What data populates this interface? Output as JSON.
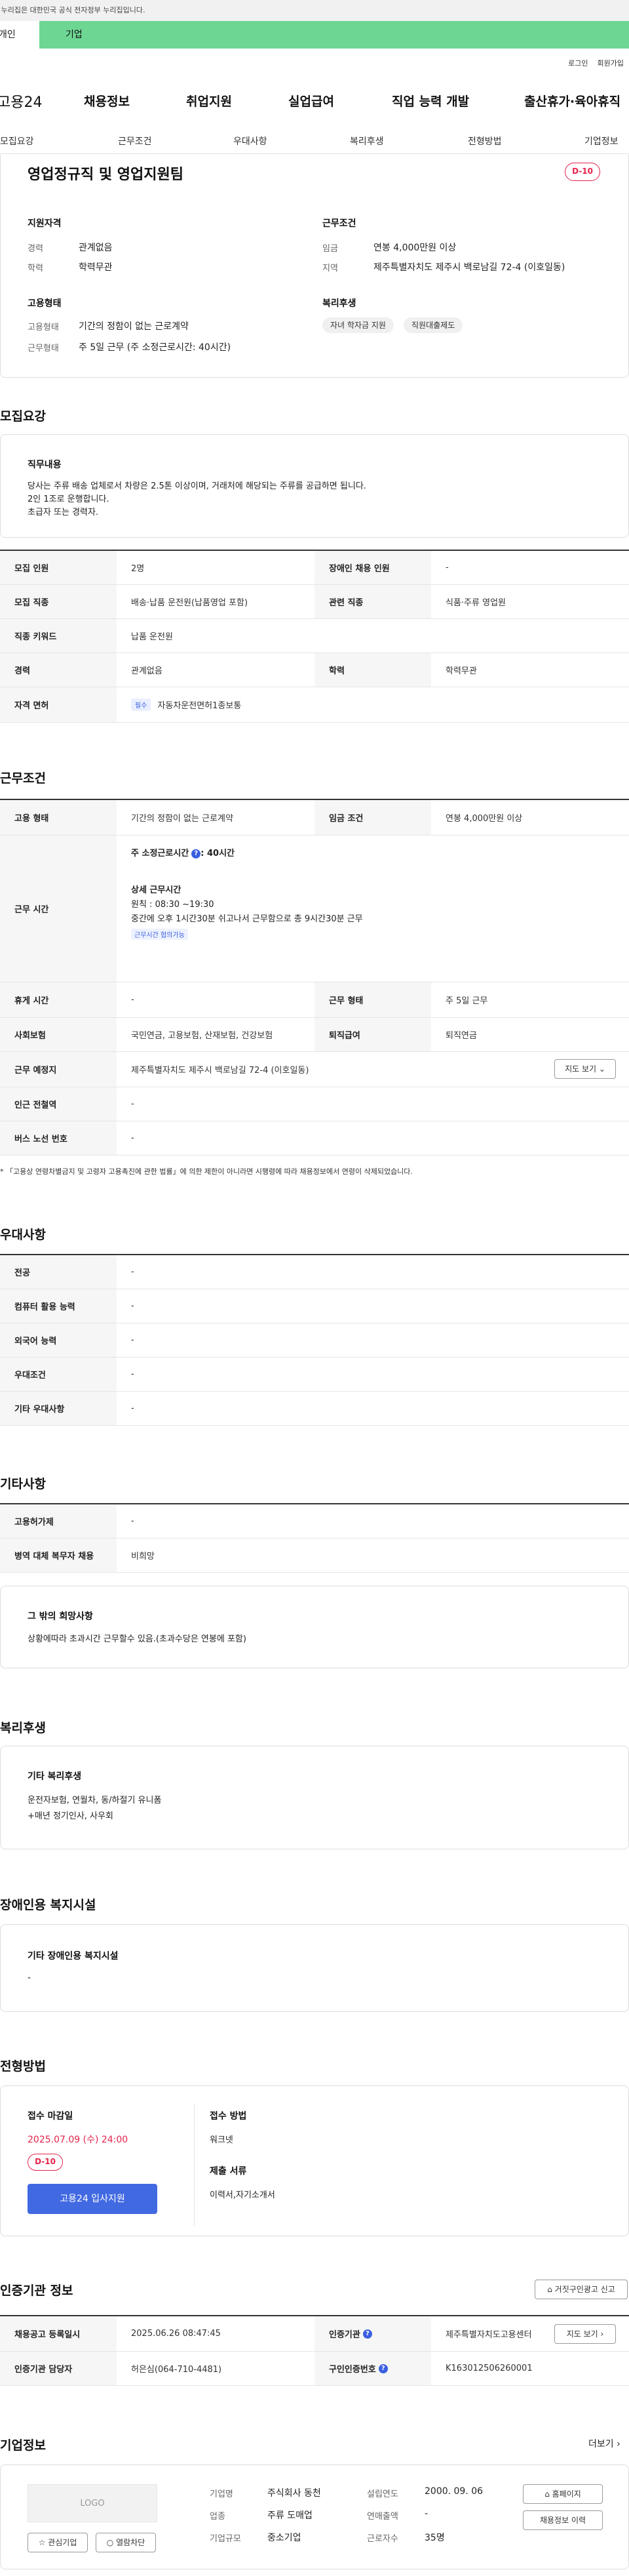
{
  "gov_banner": "이 누리집은 대한민국 공식 전자정부 누리집입니다.",
  "tabs": {
    "individual": "개인",
    "business": "기업"
  },
  "util": [
    "로그인",
    "회원가입"
  ],
  "gnb": {
    "logo": "고용24",
    "items": [
      "채용정보",
      "취업지원",
      "실업급여",
      "직업 능력 개발",
      "출산휴가·육아휴직"
    ]
  },
  "lnb": [
    "모집요강",
    "근무조건",
    "우대사항",
    "복리후생",
    "전형방법",
    "기업정보"
  ],
  "summary": {
    "title": "영업정규직 및 영업지원팀",
    "dday": "D-10",
    "qual_h": "지원자격",
    "career_l": "경력",
    "career_v": "관계없음",
    "edu_l": "학력",
    "edu_v": "학력무관",
    "cond_h": "근무조건",
    "wage_l": "임금",
    "wage_v": "연봉 4,000만원 이상",
    "region_l": "지역",
    "region_v": "제주특별자치도 제주시 백로남길 72-4 (이호일동)",
    "emp_h": "고용형태",
    "emptype_l": "고용형태",
    "emptype_v": "기간의 정함이 없는 근로계약",
    "worktype_l": "근무형태",
    "worktype_v": "주 5일 근무 (주 소정근로시간: 40시간)",
    "welfare_h": "복리후생",
    "chips": [
      "자녀 학자금 지원",
      "직원대출제도"
    ]
  },
  "recruit": {
    "h": "모집요강",
    "duty_h": "직무내용",
    "duty_lines": [
      "당사는 주류 배송 업체로서 차량은 2.5톤 이상이며, 거래처에 해당되는 주류를 공급하면 됩니다.",
      "2인 1조로 운행합니다.",
      "초급자 또는 경력자."
    ],
    "count_l": "모집 인원",
    "count_v": "2명",
    "disabled_l": "장애인 채용 인원",
    "disabled_v": "-",
    "job_l": "모집 직종",
    "job_v": "배송·납품 운전원(납품영업 포함)",
    "rel_l": "관련 직종",
    "rel_v": "식품·주류 영업원",
    "kw_l": "직종 키워드",
    "kw_v": "납품 운전원",
    "career_l": "경력",
    "career_v": "관계없음",
    "edu_l": "학력",
    "edu_v": "학력무관",
    "license_l": "자격 면허",
    "license_tag": "필수",
    "license_v": "자동차운전면허1종보통"
  },
  "work": {
    "h": "근무조건",
    "emp_l": "고용 형태",
    "emp_v": "기간의 정함이 없는 근로계약",
    "wage_l": "임금 조건",
    "wage_v": "연봉 4,000만원 이상",
    "time_l": "근무 시간",
    "weekly": "주 소정근로시간",
    "weekly_v": ": 40시간",
    "detail_h": "상세 근무시간",
    "detail1": "원칙 : 08:30 ~19:30",
    "detail2": "중간에 오후 1시간30분 쉬고나서 근무함으로 총 9시간30분 근무",
    "flex_tag": "근무시간 협의가능",
    "rest_l": "휴게 시간",
    "rest_v": "-",
    "form_l": "근무 형태",
    "form_v": "주 5일 근무",
    "ins_l": "사회보험",
    "ins_v": "국민연금, 고용보험, 산재보험, 건강보험",
    "ret_l": "퇴직급여",
    "ret_v": "퇴직연금",
    "place_l": "근무 예정지",
    "place_v": "제주특별자치도 제주시 백로남길 72-4 (이호일동)",
    "map_btn": "지도 보기",
    "station_l": "인근 전철역",
    "station_v": "-",
    "bus_l": "버스 노선 번호",
    "bus_v": "-",
    "note": "* 「고용상 연령차별금지 및 고령자 고용촉진에 관한 법률」에 의한 제한이 아니라면 시행령에 따라 채용정보에서 연령이 삭제되었습니다."
  },
  "pref": {
    "h": "우대사항",
    "rows": [
      [
        "전공",
        "-"
      ],
      [
        "컴퓨터 활용 능력",
        "-"
      ],
      [
        "외국어 능력",
        "-"
      ],
      [
        "우대조건",
        "-"
      ],
      [
        "기타 우대사항",
        "-"
      ]
    ]
  },
  "etc": {
    "h": "기타사항",
    "rows": [
      [
        "고용허가제",
        "-"
      ],
      [
        "병역 대체 복무자 채용",
        "비희망"
      ]
    ],
    "wish_h": "그 밖의 희망사항",
    "wish_v": "상황에따라 초과시간 근무할수 있음.(초과수당은 연봉에 포함)"
  },
  "welfare": {
    "h": "복리후생",
    "sub_h": "기타 복리후생",
    "lines": [
      "운전자보험, 연월차, 동/하절기 유니폼",
      "+매년 정기인사, 사우회"
    ]
  },
  "disab": {
    "h": "장애인용 복지시설",
    "sub_h": "기타 장애인용 복지시설",
    "v": "-"
  },
  "process": {
    "h": "전형방법",
    "deadline_h": "접수 마감일",
    "deadline_v": "2025.07.09 (수) 24:00",
    "dday": "D-10",
    "apply": "고용24 입사지원",
    "method_h": "접수 방법",
    "method_v": "워크넷",
    "docs_h": "제출 서류",
    "docs_v": "이력서,자기소개서"
  },
  "cert": {
    "h": "인증기관 정보",
    "report_btn": "거짓구인광고 신고",
    "reg_l": "채용공고 등록일시",
    "reg_v": "2025.06.26 08:47:45",
    "org_l": "인증기관",
    "org_v": "제주특별자치도고용센터",
    "org_btn": "지도 보기",
    "mgr_l": "인증기관 담당자",
    "mgr_v": "허은심(064-710-4481)",
    "no_l": "구인인증번호",
    "no_v": "K163012506260001"
  },
  "company": {
    "h": "기업정보",
    "more": "더보기",
    "logo": "LOGO",
    "fav": "관심기업",
    "block": "열람차단",
    "name_l": "기업명",
    "name_v": "주식회사 동천",
    "est_l": "설립연도",
    "est_v": "2000. 09. 06",
    "ind_l": "업종",
    "ind_v": "주류 도매업",
    "sales_l": "연매출액",
    "sales_v": "-",
    "size_l": "기업규모",
    "size_v": "중소기업",
    "emp_l": "근로자수",
    "emp_v": "35명",
    "home_btn": "홈페이지",
    "history_btn": "채용정보 이력"
  }
}
